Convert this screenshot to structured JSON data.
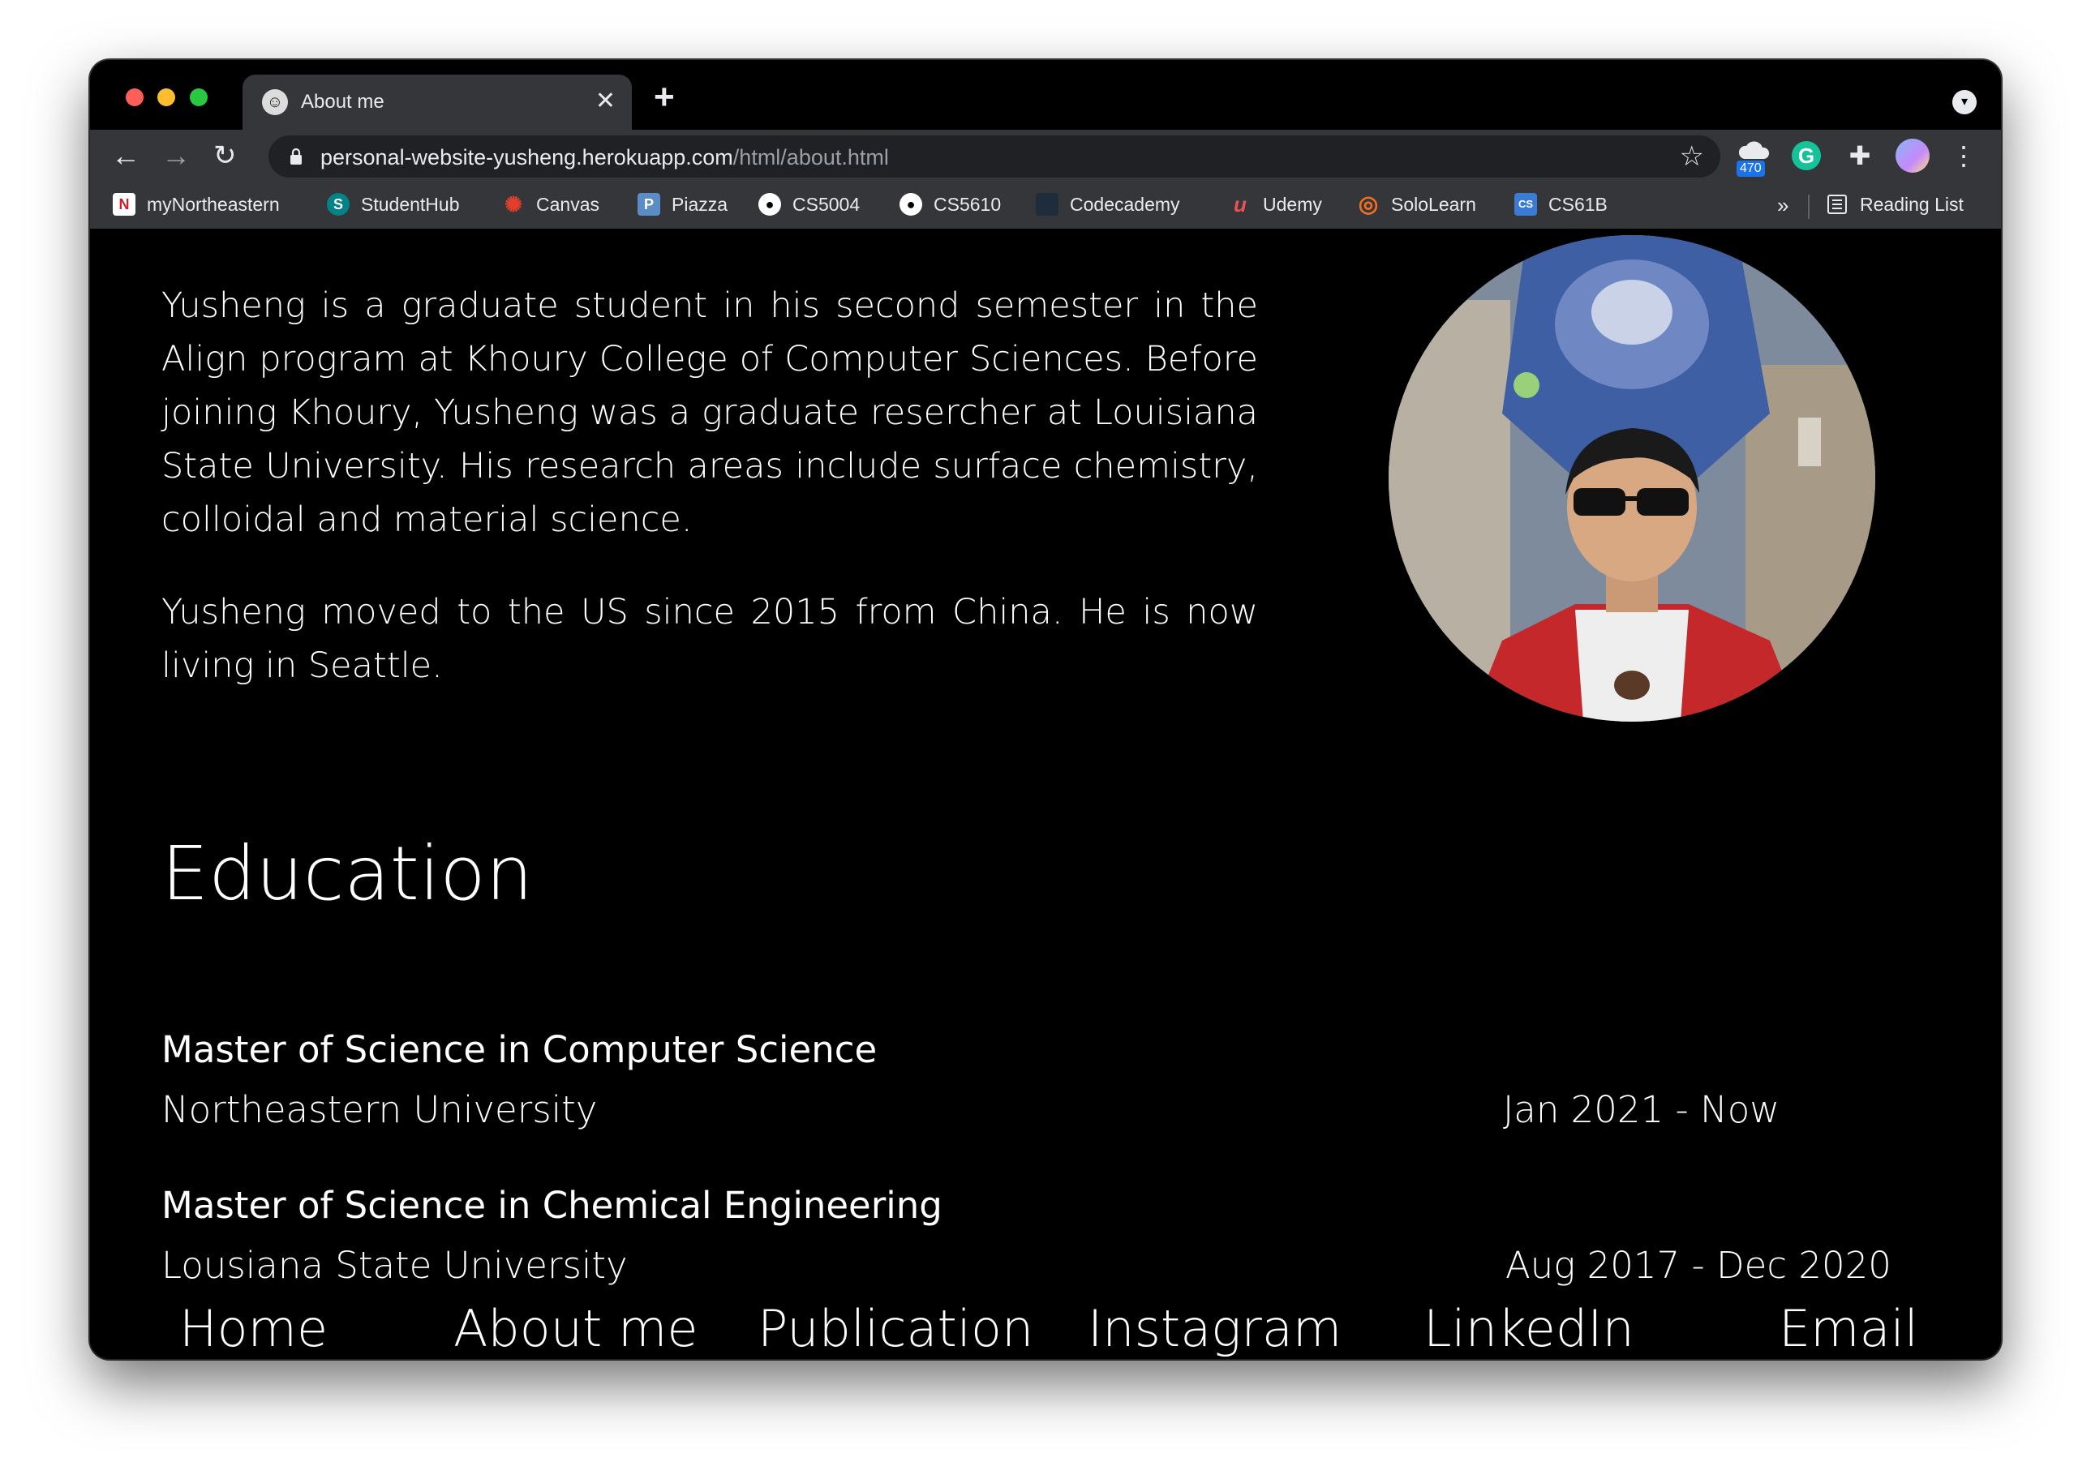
{
  "browser": {
    "tab_title": "About me",
    "url_host": "personal-website-yusheng.herokuapp.com",
    "url_path": "/html/about.html",
    "extension_badge": "470",
    "extension_g_label": "G",
    "bookmarks": [
      {
        "label": "myNortheastern",
        "icon": "northeastern-icon",
        "glyph": "N",
        "color": "#d41b2c"
      },
      {
        "label": "StudentHub",
        "icon": "sharepoint-icon",
        "glyph": "S",
        "color": "#038387"
      },
      {
        "label": "Canvas",
        "icon": "canvas-icon",
        "glyph": "✺",
        "color": "#e13f2b"
      },
      {
        "label": "Piazza",
        "icon": "piazza-icon",
        "glyph": "P",
        "color": "#5a8dc7"
      },
      {
        "label": "CS5004",
        "icon": "github-icon",
        "glyph": "●",
        "color": "#000000"
      },
      {
        "label": "CS5610",
        "icon": "github-icon",
        "glyph": "●",
        "color": "#000000"
      },
      {
        "label": "Codecademy",
        "icon": "codecademy-icon",
        "glyph": "",
        "color": "#1f2c3c"
      },
      {
        "label": "Udemy",
        "icon": "udemy-icon",
        "glyph": "u",
        "color": "#ec5252"
      },
      {
        "label": "SoloLearn",
        "icon": "sololearn-icon",
        "glyph": "◎",
        "color": "#f26f21"
      },
      {
        "label": "CS61B",
        "icon": "cs61b-icon",
        "glyph": "CS",
        "color": "#3a7bd5"
      }
    ],
    "more_label": "»",
    "reading_list": "Reading List"
  },
  "bio": {
    "paragraph1": "Yusheng is a graduate student in his second semester in the Align program at Khoury College of Computer Sciences. Before joining Khoury, Yusheng was a graduate resercher at Louisiana State University. His research areas include surface chemistry, colloidal and material science.",
    "paragraph2": "Yusheng moved to the US since 2015 from China. He is now living in Seattle."
  },
  "education": {
    "title": "Education",
    "entries": [
      {
        "degree": "Master of Science in Computer Science",
        "school": "Northeastern University",
        "dates": "Jan 2021 - Now"
      },
      {
        "degree": "Master of Science in Chemical Engineering",
        "school": "Lousiana State University",
        "dates": "Aug 2017 - Dec 2020"
      }
    ]
  },
  "footer_nav": [
    "Home",
    "About me",
    "Publication",
    "Instagram",
    "LinkedIn",
    "Email"
  ]
}
